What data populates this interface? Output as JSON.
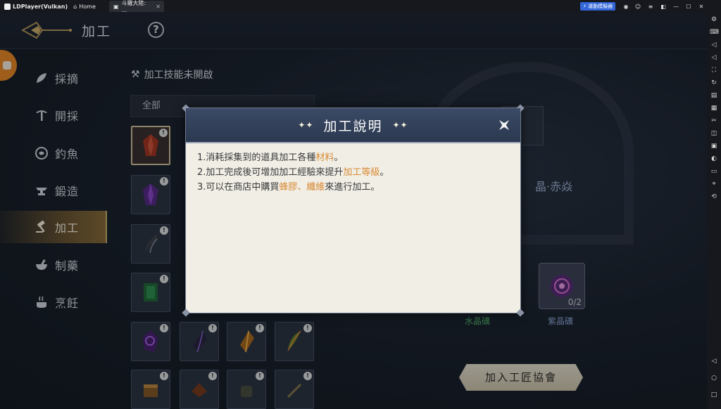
{
  "titlebar": {
    "app_name": "LDPlayer(Vulkan)",
    "home_label": "Home",
    "tab_label": "斗羅大陸: ...",
    "badge_label": "運動模擬器"
  },
  "game": {
    "page_title": "加工",
    "help_symbol": "?",
    "menu": [
      {
        "label": "採摘",
        "icon": "leaf-icon",
        "active": false
      },
      {
        "label": "開採",
        "icon": "pickaxe-icon",
        "active": false
      },
      {
        "label": "釣魚",
        "icon": "fish-icon",
        "active": false
      },
      {
        "label": "鍛造",
        "icon": "anvil-icon",
        "active": false
      },
      {
        "label": "加工",
        "icon": "hammer-icon",
        "active": true
      },
      {
        "label": "制藥",
        "icon": "mortar-icon",
        "active": false
      },
      {
        "label": "烹飪",
        "icon": "cooking-pot-icon",
        "active": false
      }
    ],
    "skill_status": "加工技能未開啟",
    "filter_value": "全部",
    "crystal_name": "晶·赤焱",
    "materials": [
      {
        "label": "水晶礦",
        "color": "#4fb06a"
      },
      {
        "label": "紫晶礦",
        "color": "#8ea6d9",
        "count": "0/2"
      }
    ],
    "guild_button": "加入工匠協會"
  },
  "modal": {
    "title": "加工說明",
    "sparkle": "✦✦",
    "lines": [
      {
        "prefix": "1.消耗採集到的道具加工各種",
        "highlight": "材料",
        "suffix": "。"
      },
      {
        "prefix": "2.加工完成後可增加加工經驗來提升",
        "highlight": "加工等級",
        "suffix": "。"
      },
      {
        "prefix": "3.可以在商店中購買",
        "highlight": "蜂膠、纖維",
        "suffix": "來進行加工。"
      }
    ]
  },
  "colors": {
    "highlight": "#d88a34",
    "active_menu": "#8a6c38",
    "modal_header": "#3b4a65"
  }
}
